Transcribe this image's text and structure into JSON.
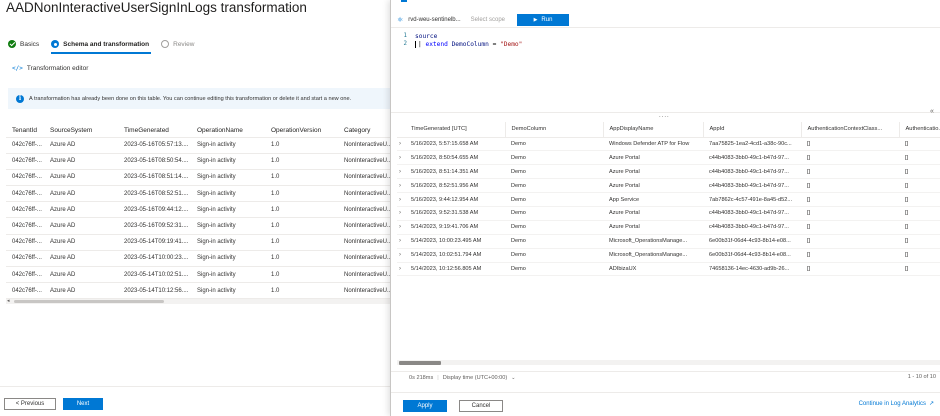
{
  "page": {
    "title": "AADNonInteractiveUserSignInLogs transformation",
    "more": "···"
  },
  "steps": [
    {
      "label": "Basics",
      "state": "done"
    },
    {
      "label": "Schema and transformation",
      "state": "current"
    },
    {
      "label": "Review",
      "state": "pending"
    }
  ],
  "editor_link": {
    "icon": "</>",
    "label": "Transformation editor"
  },
  "info": {
    "icon": "i",
    "text": "A transformation has already been done on this table. You can continue editing this transformation or delete it and start a new one."
  },
  "left_table": {
    "columns": [
      "TenantId",
      "SourceSystem",
      "TimeGenerated",
      "OperationName",
      "OperationVersion",
      "Category"
    ],
    "rows": [
      [
        "042c76ff-...",
        "Azure AD",
        "2023-05-16T05:57:13....",
        "Sign-in activity",
        "1.0",
        "NonInteractiveU..."
      ],
      [
        "042c76ff-...",
        "Azure AD",
        "2023-05-16T08:50:54....",
        "Sign-in activity",
        "1.0",
        "NonInteractiveU..."
      ],
      [
        "042c76ff-...",
        "Azure AD",
        "2023-05-16T08:51:14....",
        "Sign-in activity",
        "1.0",
        "NonInteractiveU..."
      ],
      [
        "042c76ff-...",
        "Azure AD",
        "2023-05-16T08:52:51....",
        "Sign-in activity",
        "1.0",
        "NonInteractiveU..."
      ],
      [
        "042c76ff-...",
        "Azure AD",
        "2023-05-16T09:44:12....",
        "Sign-in activity",
        "1.0",
        "NonInteractiveU..."
      ],
      [
        "042c76ff-...",
        "Azure AD",
        "2023-05-16T09:52:31....",
        "Sign-in activity",
        "1.0",
        "NonInteractiveU..."
      ],
      [
        "042c76ff-...",
        "Azure AD",
        "2023-05-14T09:19:41....",
        "Sign-in activity",
        "1.0",
        "NonInteractiveU..."
      ],
      [
        "042c76ff-...",
        "Azure AD",
        "2023-05-14T10:00:23....",
        "Sign-in activity",
        "1.0",
        "NonInteractiveU..."
      ],
      [
        "042c76ff-...",
        "Azure AD",
        "2023-05-14T10:02:51....",
        "Sign-in activity",
        "1.0",
        "NonInteractiveU..."
      ],
      [
        "042c76ff-...",
        "Azure AD",
        "2023-05-14T10:12:56....",
        "Sign-in activity",
        "1.0",
        "NonInteractiveU..."
      ]
    ]
  },
  "left_footer": {
    "previous": "< Previous",
    "next": "Next"
  },
  "panel": {
    "workspace": "rvd-weu-sentinelbase-la",
    "scope": "rvd-weu-sentinelb...",
    "select_scope": "Select scope",
    "run": "Run",
    "run_icon": "▶",
    "code": {
      "line1_no": "1",
      "line1": "source",
      "line2_no": "2",
      "line2_pipe": "|",
      "line2_kw": "extend",
      "line2_id": "DemoColumn",
      "line2_op": "=",
      "line2_str": "\"Demo\""
    },
    "ellipsis": "....",
    "collapse_icon": "«",
    "results": {
      "columns": [
        "TimeGenerated [UTC]",
        "DemoColumn",
        "AppDisplayName",
        "AppId",
        "AuthenticationContextClass...",
        "Authenticatio..."
      ],
      "rows": [
        [
          "5/16/2023, 5:57:15.658 AM",
          "Demo",
          "Windows Defender ATP for Flow",
          "7aa75825-1ea2-4cd1-a38c-90c...",
          "[]",
          "[]"
        ],
        [
          "5/16/2023, 8:50:54.655 AM",
          "Demo",
          "Azure Portal",
          "c44b4083-3bb0-49c1-b47d-97...",
          "[]",
          "[]"
        ],
        [
          "5/16/2023, 8:51:14.351 AM",
          "Demo",
          "Azure Portal",
          "c44b4083-3bb0-49c1-b47d-97...",
          "[]",
          "[]"
        ],
        [
          "5/16/2023, 8:52:51.956 AM",
          "Demo",
          "Azure Portal",
          "c44b4083-3bb0-49c1-b47d-97...",
          "[]",
          "[]"
        ],
        [
          "5/16/2023, 9:44:12.954 AM",
          "Demo",
          "App Service",
          "7ab7862c-4c57-491e-8a45-d52...",
          "[]",
          "[]"
        ],
        [
          "5/16/2023, 9:52:31.538 AM",
          "Demo",
          "Azure Portal",
          "c44b4083-3bb0-49c1-b47d-97...",
          "[]",
          "[]"
        ],
        [
          "5/14/2023, 9:19:41.706 AM",
          "Demo",
          "Azure Portal",
          "c44b4083-3bb0-49c1-b47d-97...",
          "[]",
          "[]"
        ],
        [
          "5/14/2023, 10:00:23.495 AM",
          "Demo",
          "Microsoft_OperationsManage...",
          "6e00b31f-06d4-4c93-8b14-e08...",
          "[]",
          "[]"
        ],
        [
          "5/14/2023, 10:02:51.794 AM",
          "Demo",
          "Microsoft_OperationsManage...",
          "6e00b31f-06d4-4c93-8b14-e08...",
          "[]",
          "[]"
        ],
        [
          "5/14/2023, 10:12:56.805 AM",
          "Demo",
          "ADIbizaUX",
          "74658136-14ec-4630-ad9b-26...",
          "[]",
          "[]"
        ]
      ]
    },
    "status": {
      "duration": "0s 218ms",
      "timezone": "Display time (UTC+00:00)",
      "count": "1 - 10 of 10"
    },
    "footer": {
      "apply": "Apply",
      "cancel": "Cancel",
      "link": "Continue in Log Analytics",
      "link_icon": "↗"
    }
  },
  "colors": {
    "accent": "#0078d4",
    "success": "#107c10"
  }
}
